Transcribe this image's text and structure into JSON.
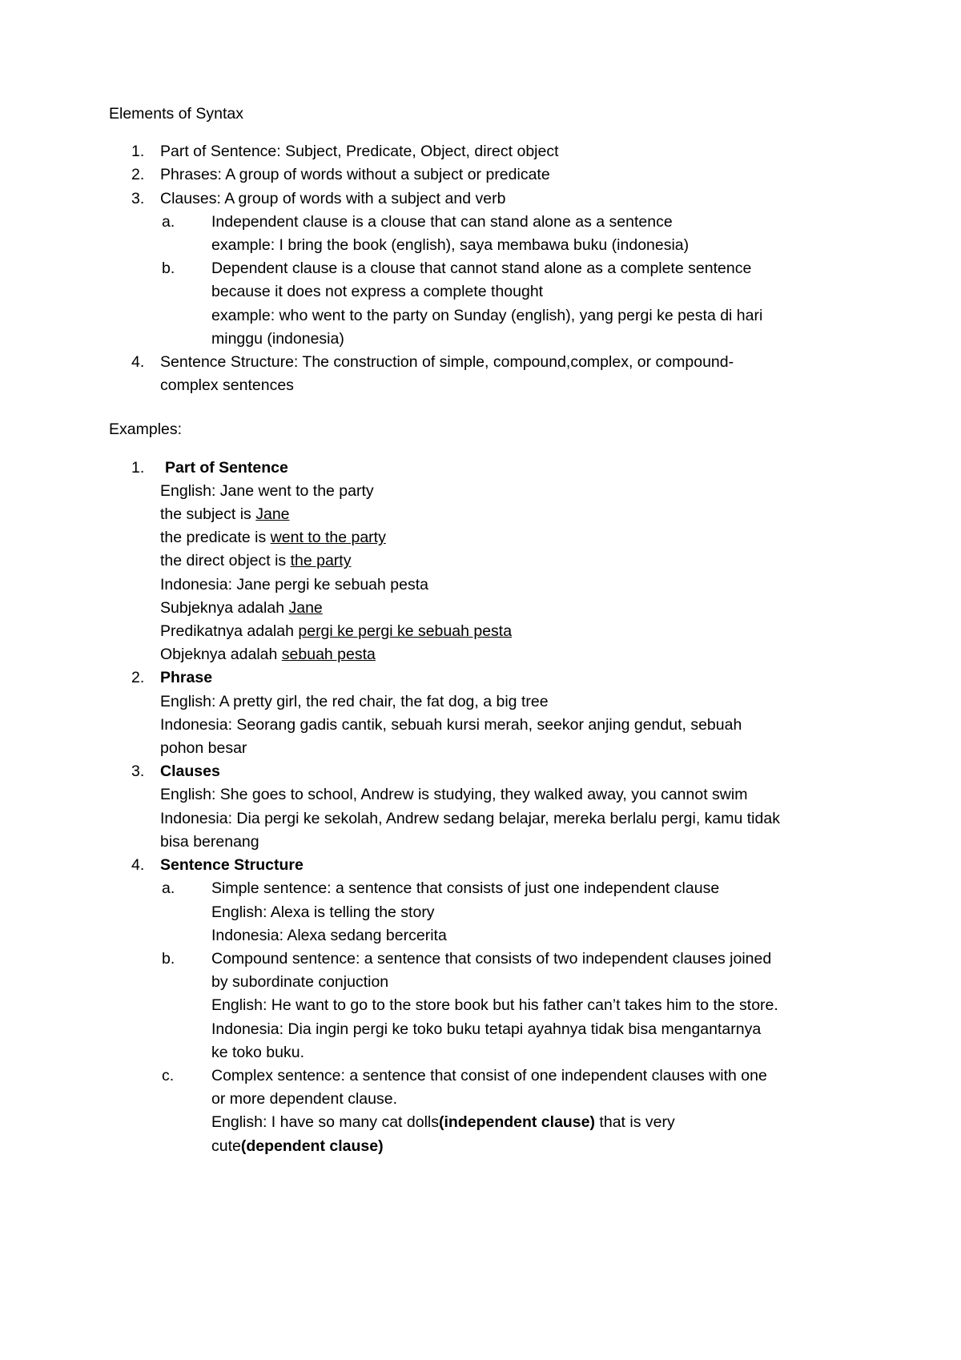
{
  "document": {
    "title": "Elements of Syntax",
    "examples_label": "Examples:",
    "outline": [
      {
        "marker": "1.",
        "text": "Part of Sentence: Subject, Predicate, Object, direct object"
      },
      {
        "marker": "2.",
        "text": "Phrases: A group of words without a subject or predicate"
      },
      {
        "marker": "3.",
        "text": "Clauses: A group of words with a subject and verb",
        "sub": [
          {
            "marker": "a.",
            "text": "Independent clause is a clouse that can stand alone as a sentence",
            "example": "example: I bring the book (english), saya membawa buku (indonesia)"
          },
          {
            "marker": "b.",
            "text": "Dependent clause is a clouse that cannot stand alone as a complete sentence because it does not express a complete thought",
            "example": "example: who went to the party on Sunday (english), yang pergi ke pesta di hari minggu (indonesia)"
          }
        ]
      },
      {
        "marker": "4.",
        "text": "Sentence Structure: The construction of simple, compound,complex, or compound-complex sentences"
      }
    ],
    "examples": [
      {
        "marker": "1.",
        "heading": "Part of Sentence",
        "lines": [
          {
            "prefix": "English: Jane went to the party",
            "underline": ""
          },
          {
            "prefix": "the subject is ",
            "underline": "Jane"
          },
          {
            "prefix": "the predicate is ",
            "underline": "went to the party"
          },
          {
            "prefix": "the direct object is ",
            "underline": "the party"
          },
          {
            "prefix": "Indonesia: Jane pergi ke sebuah pesta",
            "underline": ""
          },
          {
            "prefix": "Subjeknya adalah ",
            "underline": "Jane"
          },
          {
            "prefix": "Predikatnya adalah ",
            "underline": "pergi ke pergi ke sebuah pesta"
          },
          {
            "prefix": "Objeknya adalah ",
            "underline": "sebuah pesta"
          }
        ]
      },
      {
        "marker": "2.",
        "heading": "Phrase",
        "lines": [
          {
            "prefix": "English: A pretty girl, the red chair, the fat dog, a big tree",
            "underline": ""
          },
          {
            "prefix": "Indonesia: Seorang gadis cantik, sebuah kursi merah, seekor anjing gendut, sebuah pohon besar",
            "underline": ""
          }
        ]
      },
      {
        "marker": "3.",
        "heading": "Clauses",
        "lines": [
          {
            "prefix": "English: She goes to school, Andrew is studying, they walked away, you cannot swim",
            "underline": ""
          },
          {
            "prefix": "Indonesia: Dia pergi ke sekolah, Andrew sedang belajar, mereka berlalu pergi, kamu tidak bisa berenang",
            "underline": ""
          }
        ]
      },
      {
        "marker": "4.",
        "heading": "Sentence Structure",
        "sub": [
          {
            "marker": "a.",
            "text": "Simple sentence: a sentence that consists of just one independent clause",
            "lines": [
              "English: Alexa is telling the story",
              "Indonesia: Alexa sedang bercerita"
            ]
          },
          {
            "marker": "b.",
            "text": "Compound sentence: a sentence that consists of two independent clauses joined by subordinate conjuction",
            "lines": [
              "English: He want to go to the store book but his father can’t takes him to the store.",
              "Indonesia: Dia ingin pergi ke toko buku tetapi ayahnya tidak bisa mengantarnya ke toko buku."
            ]
          },
          {
            "marker": "c.",
            "text": "Complex sentence: a sentence that consist of one independent clauses with one or more dependent clause.",
            "rich_line": {
              "part1": "English:  I have so many cat dolls",
              "bold1": "(independent clause)",
              "part2": " that is very cute",
              "bold2": "(dependent clause)"
            }
          }
        ]
      }
    ]
  }
}
